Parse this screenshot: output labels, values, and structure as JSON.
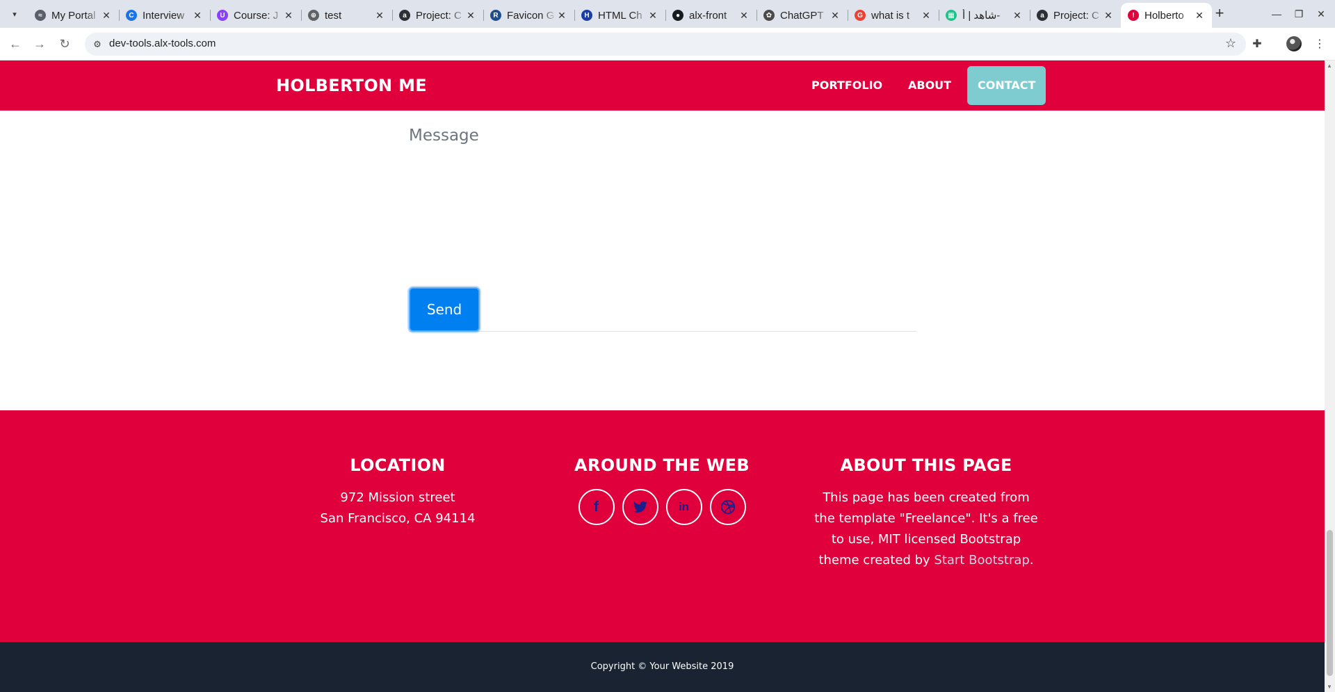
{
  "browser": {
    "tabs": [
      {
        "title": "My Portal",
        "favicon_color": "#5a5f6b",
        "favicon_glyph": "≈"
      },
      {
        "title": "Interview",
        "favicon_color": "#1a73e8",
        "favicon_glyph": "C"
      },
      {
        "title": "Course: J",
        "favicon_color": "#8a3ffc",
        "favicon_glyph": "U"
      },
      {
        "title": "test",
        "favicon_color": "#5f6368",
        "favicon_glyph": "⊕"
      },
      {
        "title": "Project: C",
        "favicon_color": "#2b2f36",
        "favicon_glyph": "a"
      },
      {
        "title": "Favicon G",
        "favicon_color": "#1f4e8c",
        "favicon_glyph": "R"
      },
      {
        "title": "HTML Ch",
        "favicon_color": "#1a3ea8",
        "favicon_glyph": "H"
      },
      {
        "title": "alx-front",
        "favicon_color": "#161b22",
        "favicon_glyph": "●"
      },
      {
        "title": "ChatGPT",
        "favicon_color": "#4a4a4a",
        "favicon_glyph": "✿"
      },
      {
        "title": "what is t",
        "favicon_color": "#ea4335",
        "favicon_glyph": "G"
      },
      {
        "title": "شاهد | أ-",
        "favicon_color": "#1ec28b",
        "favicon_glyph": "▦"
      },
      {
        "title": "Project: C",
        "favicon_color": "#2b2f36",
        "favicon_glyph": "a"
      },
      {
        "title": "Holberto",
        "favicon_color": "#e0003b",
        "favicon_glyph": "!",
        "active": true
      }
    ],
    "url": "dev-tools.alx-tools.com",
    "icons": {
      "tab_search": "chevron-down-icon",
      "new_tab": "plus-icon",
      "back": "arrow-left-icon",
      "forward": "arrow-right-icon",
      "reload": "reload-icon",
      "site_info": "tune-icon",
      "bookmark": "star-icon",
      "extensions": "puzzle-icon",
      "menu": "kebab-menu-icon"
    }
  },
  "navbar": {
    "brand": "HOLBERTON ME",
    "links": [
      {
        "label": "PORTFOLIO",
        "active": false
      },
      {
        "label": "ABOUT",
        "active": false
      },
      {
        "label": "CONTACT",
        "active": true
      }
    ]
  },
  "contact_form": {
    "message_placeholder": "Message",
    "message_value": "",
    "send_label": "Send"
  },
  "footer": {
    "location": {
      "heading": "LOCATION",
      "line1": "972 Mission street",
      "line2": "San Francisco, CA 94114"
    },
    "around_the_web": {
      "heading": "AROUND THE WEB",
      "social": [
        {
          "name": "facebook-icon",
          "glyph": "f"
        },
        {
          "name": "twitter-icon",
          "glyph": "🐦"
        },
        {
          "name": "linkedin-icon",
          "glyph": "in"
        },
        {
          "name": "dribbble-icon",
          "glyph": "◎"
        }
      ]
    },
    "about": {
      "heading": "ABOUT THIS PAGE",
      "text": "This page has been created from the template \"Freelance\". It's a free to use, MIT licensed Bootstrap theme created by ",
      "link_text": "Start Bootstrap",
      "text_end": "."
    },
    "copyright": "Copyright © Your Website 2019"
  },
  "colors": {
    "brand_red": "#e0003b",
    "active_nav": "#7ecbd0",
    "send_button": "#0080f0",
    "copyright_bg": "#1a2332",
    "social_icon": "#1a1f8c"
  }
}
